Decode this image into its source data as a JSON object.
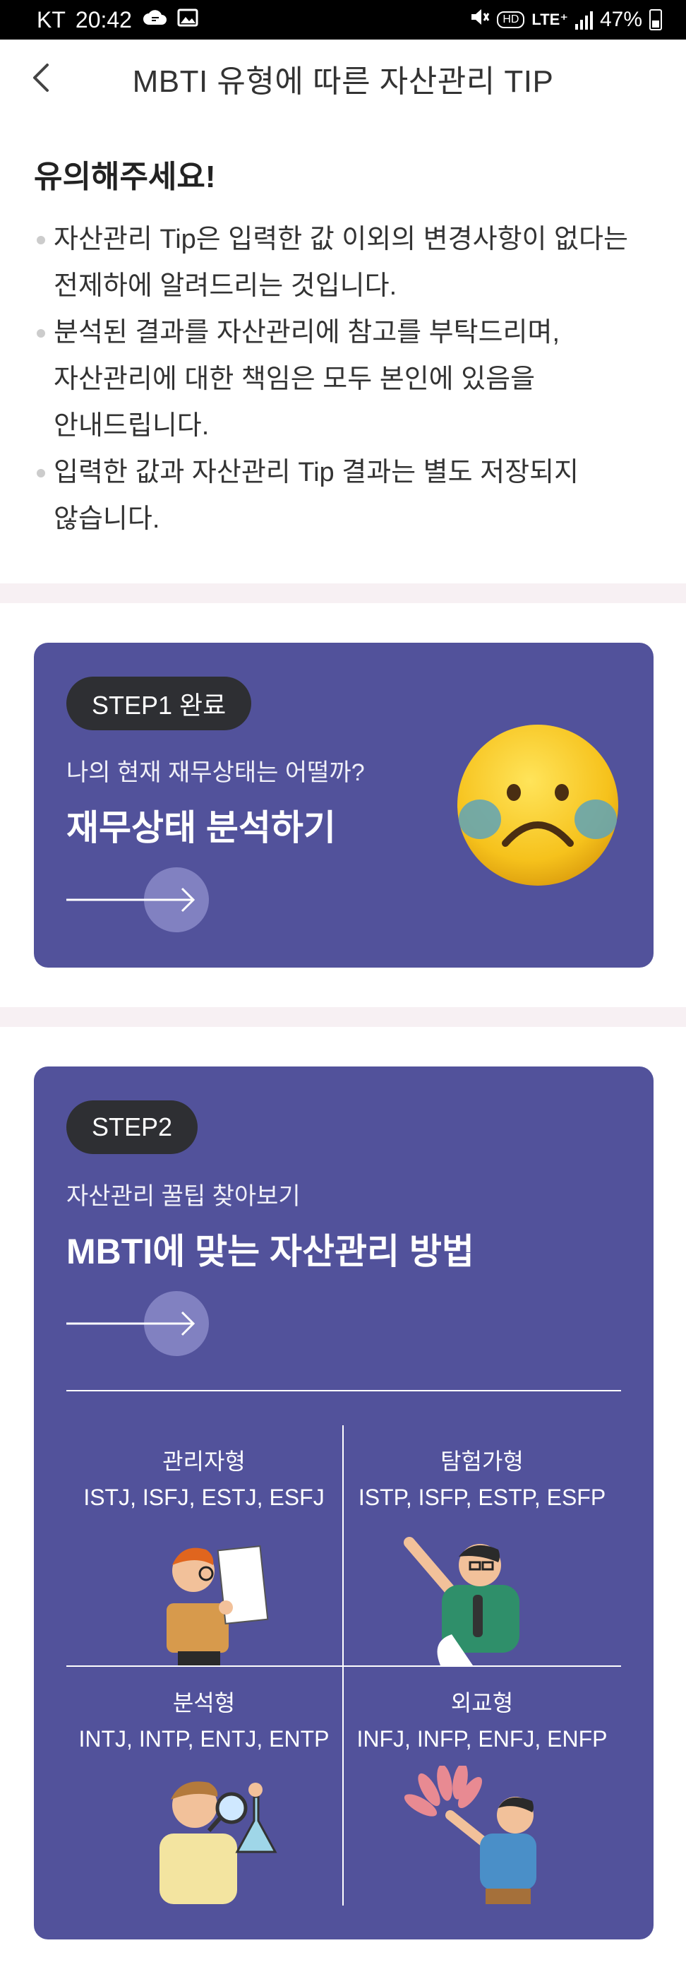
{
  "status_bar": {
    "carrier": "KT",
    "time": "20:42",
    "network": "LTE⁺",
    "battery": "47%"
  },
  "header": {
    "title": "MBTI 유형에 따른 자산관리 TIP"
  },
  "notice": {
    "title": "유의해주세요!",
    "items": [
      {
        "line1": "자산관리 Tip은 입력한 값 이외의 변경사항이 없다는",
        "line2": "전제하에 알려드리는 것입니다.",
        "line3": ""
      },
      {
        "line1": "분석된 결과를 자산관리에 참고를 부탁드리며,",
        "line2": "자산관리에 대한 책임은 모두 본인에 있음을",
        "line3": "안내드립니다."
      },
      {
        "line1": "입력한 값과 자산관리 Tip 결과는 별도 저장되지",
        "line2": "않습니다.",
        "line3": ""
      }
    ]
  },
  "step1": {
    "badge": "STEP1 완료",
    "subtitle": "나의 현재 재무상태는 어떨까?",
    "title": "재무상태 분석하기"
  },
  "step2": {
    "badge": "STEP2",
    "subtitle": "자산관리 꿀팁 찾아보기",
    "title": "MBTI에 맞는 자산관리 방법",
    "types": [
      {
        "name": "관리자형",
        "codes": "ISTJ, ISFJ, ESTJ, ESFJ"
      },
      {
        "name": "탐험가형",
        "codes": "ISTP, ISFP, ESTP, ESFP"
      },
      {
        "name": "분석형",
        "codes": "INTJ, INTP, ENTJ, ENTP"
      },
      {
        "name": "외교형",
        "codes": "INFJ, INFP, ENFJ, ENFP"
      }
    ]
  },
  "colors": {
    "card_background": "#52529b",
    "pill_background": "#2e2f33",
    "divider_band": "#f7f0f3"
  },
  "icons": {
    "back": "chevron-left-icon",
    "arrow": "arrow-right-circle-icon",
    "emoji": "sad-face-emoji-icon"
  }
}
